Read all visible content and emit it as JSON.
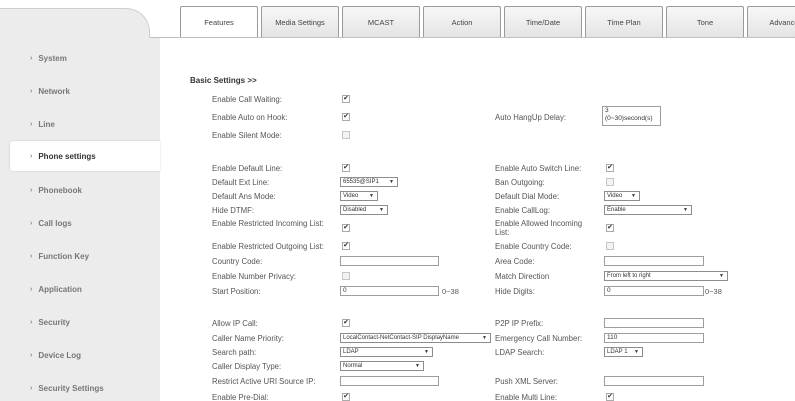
{
  "tabs": [
    "Features",
    "Media Settings",
    "MCAST",
    "Action",
    "Time/Date",
    "Time Plan",
    "Tone",
    "Advanced"
  ],
  "sidebar": {
    "items": [
      {
        "label": "System"
      },
      {
        "label": "Network"
      },
      {
        "label": "Line"
      },
      {
        "label": "Phone settings"
      },
      {
        "label": "Phonebook"
      },
      {
        "label": "Call logs"
      },
      {
        "label": "Function Key"
      },
      {
        "label": "Application"
      },
      {
        "label": "Security"
      },
      {
        "label": "Device Log"
      },
      {
        "label": "Security Settings"
      }
    ]
  },
  "main": {
    "section_title": "Basic Settings >>",
    "left": {
      "call_waiting": "Enable Call Waiting:",
      "auto_on_hook": "Enable Auto on Hook:",
      "silent_mode": "Enable Silent Mode:",
      "default_line": "Enable Default Line:",
      "default_ext_line": "Default Ext Line:",
      "default_ext_line_value": "65535@SIP1",
      "default_ans_mode": "Default Ans Mode:",
      "default_ans_mode_value": "Video",
      "hide_dtmf": "Hide DTMF:",
      "hide_dtmf_value": "Disabled",
      "restricted_incoming": "Enable Restricted Incoming List:",
      "restricted_outgoing": "Enable Restricted Outgoing List:",
      "country_code": "Country Code:",
      "number_privacy": "Enable Number Privacy:",
      "start_position": "Start Position:",
      "start_position_value": "0",
      "start_position_range": "0~38",
      "allow_ip_call": "Allow IP Call:",
      "caller_name_priority": "Caller Name Priority:",
      "caller_name_priority_value": "LocalContact-NetContact-SIP DisplayName",
      "search_path": "Search path:",
      "search_path_value": "LDAP",
      "caller_display_type": "Caller Display Type:",
      "caller_display_type_value": "Normal",
      "restrict_active_uri": "Restrict Active URI Source IP:",
      "pre_dial": "Enable Pre-Dial:"
    },
    "right": {
      "auto_hangup_delay": "Auto HangUp Delay:",
      "auto_hangup_delay_value": "3",
      "auto_hangup_delay_hint": "(0~30)second(s)",
      "auto_switch_line": "Enable Auto Switch Line:",
      "ban_outgoing": "Ban Outgoing:",
      "default_dial_mode": "Default Dial Mode:",
      "default_dial_mode_value": "Video",
      "enable_calllog": "Enable CallLog:",
      "enable_calllog_value": "Enable",
      "allowed_incoming": "Enable Allowed Incoming List:",
      "country_code_enable": "Enable Country Code:",
      "area_code": "Area Code:",
      "match_direction": "Match Direction",
      "match_direction_value": "From left to right",
      "hide_digits": "Hide Digits:",
      "hide_digits_value": "0",
      "hide_digits_range": "0~38",
      "p2p_ip_prefix": "P2P IP Prefix:",
      "emergency_call_number": "Emergency Call Number:",
      "emergency_call_number_value": "110",
      "ldap_search": "LDAP Search:",
      "ldap_search_value": "LDAP 1",
      "push_xml_server": "Push XML Server:",
      "multi_line": "Enable Multi Line:"
    }
  }
}
